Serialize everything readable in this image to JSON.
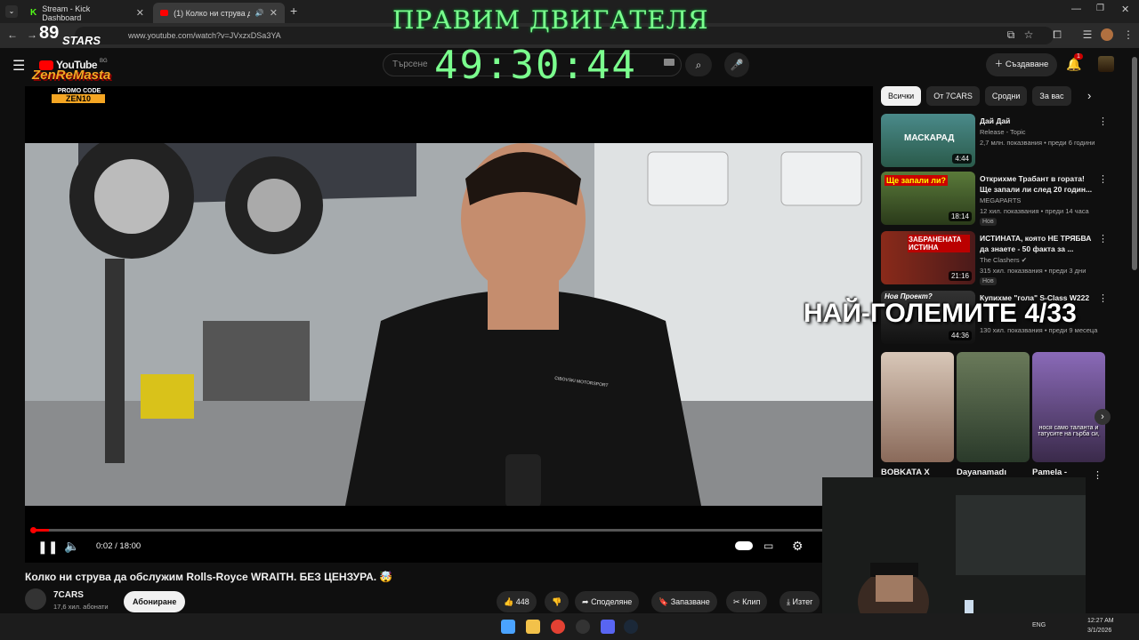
{
  "browser": {
    "tabs": [
      {
        "label": "Stream - Kick Dashboard",
        "icon": "kick-icon"
      },
      {
        "label": "(1) Колко ни струва да об...",
        "icon": "youtube-icon"
      }
    ],
    "url": "www.youtube.com/watch?v=JVxzxDSa3YA",
    "new_tab": "+"
  },
  "youtube": {
    "logo": "YouTube",
    "logo_region": "BG",
    "search_placeholder": "Търсене",
    "create_label": "Създаване",
    "notification_count": "1"
  },
  "overlays": {
    "title": "ПРАВИМ ДВИГАТЕЛЯ",
    "timer": "49:30:44",
    "side_text": "НАЙ-ГОЛЕМИТЕ 4/33",
    "logo_stars": "STARS",
    "logo_number": "89",
    "sponsor_name": "ZenReMasta",
    "promo_line1": "PROMO CODE",
    "promo_line2": "ZEN10"
  },
  "player": {
    "time_current": "0:02",
    "time_total": "18:00",
    "progress": 0.002,
    "shirt_text": "CIBOVSKI MOTORSPORT"
  },
  "video": {
    "title": "Колко ни струва да обслужим Rolls-Royce WRAITH. БЕЗ ЦЕНЗУРА. 🤯",
    "channel": "7CARS",
    "subscribers": "17,6 хил. абонати",
    "subscribe_label": "Абониране",
    "likes": "448",
    "share_label": "Споделяне",
    "save_label": "Запазване",
    "clip_label": "Клип",
    "download_label": "Изтег"
  },
  "chips": [
    "Всички",
    "От 7CARS",
    "Сродни",
    "За вас"
  ],
  "recommendations": [
    {
      "title": "Дай Дай",
      "channel": "Release - Topic",
      "meta": "2,7 млн. показвания • преди 6 години",
      "duration": "4:44",
      "thumb_text": "МАСКАРАД"
    },
    {
      "title": "Открихме Трабант в гората! Ще запали ли след 20 годин...",
      "channel": "MEGAPARTS",
      "meta": "12 хил. показвания • преди 14 часа",
      "badge": "Нов",
      "duration": "18:14",
      "thumb_text": "Ще запали ли?"
    },
    {
      "title": "ИСТИНАТА, която НЕ ТРЯБВА да знаете - 50 факта за ...",
      "channel": "The Clashers",
      "meta": "315 хил. показвания • преди 3 дни",
      "badge": "Нов",
      "duration": "21:16",
      "thumb_text": "ЗАБРАНЕНАТА ИСТИНА"
    },
    {
      "title": "Купихме \"гола\" S-Class W222",
      "channel": "",
      "meta": "130 хил. показвания • преди 9 месеца",
      "duration": "44:36",
      "thumb_text": "Нов Проект?"
    }
  ],
  "shorts": [
    {
      "name": "BOBKATA X"
    },
    {
      "name": "Dayanamadı"
    },
    {
      "name": "Pamela -",
      "caption": "нося само таланта и татусите на гърба си,"
    }
  ],
  "taskbar": {
    "time": "12:27 AM",
    "date": "3/1/2026",
    "lang": "ENG"
  }
}
